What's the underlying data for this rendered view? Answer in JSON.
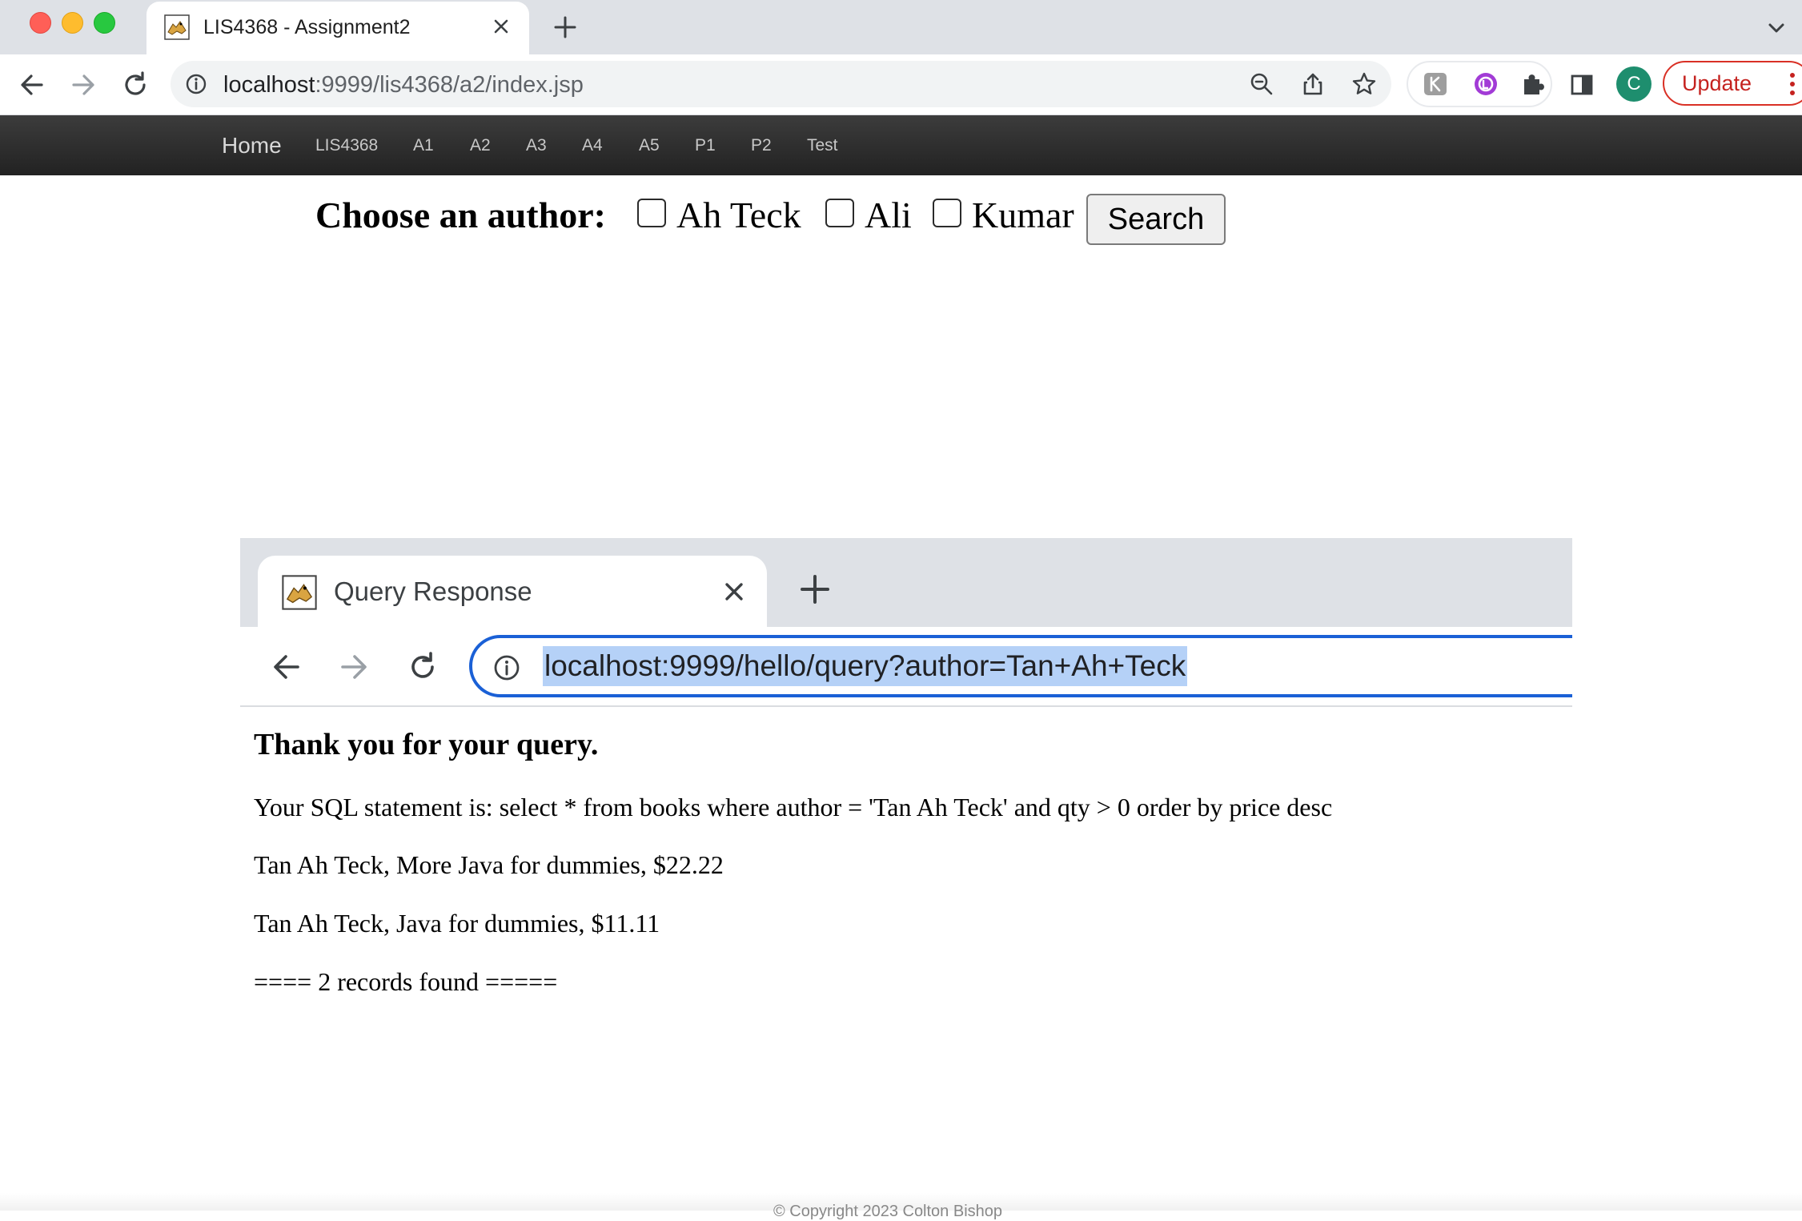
{
  "browser": {
    "tab_title": "LIS4368 - Assignment2",
    "url_host": "localhost",
    "url_path": ":9999/lis4368/a2/index.jsp",
    "profile_initial": "C",
    "update_label": "Update",
    "colors": {
      "accent_blue": "#1a60d6",
      "update_red": "#c5221f",
      "profile_green": "#1e8e6e"
    }
  },
  "sitenav": {
    "brand": "Home",
    "items": [
      "LIS4368",
      "A1",
      "A2",
      "A3",
      "A4",
      "A5",
      "P1",
      "P2",
      "Test"
    ]
  },
  "form": {
    "label": "Choose an author:",
    "options": [
      "Ah Teck",
      "Ali",
      "Kumar"
    ],
    "button": "Search"
  },
  "response": {
    "tab_title": "Query Response",
    "url": "localhost:9999/hello/query?author=Tan+Ah+Teck",
    "heading": "Thank you for your query.",
    "sql_line": "Your SQL statement is: select * from books where author = 'Tan Ah Teck' and qty > 0 order by price desc",
    "results": [
      "Tan Ah Teck, More Java for dummies, $22.22",
      "Tan Ah Teck, Java for dummies, $11.11"
    ],
    "summary": "==== 2 records found ====="
  },
  "footer": {
    "text": "© Copyright 2023 Colton Bishop"
  }
}
